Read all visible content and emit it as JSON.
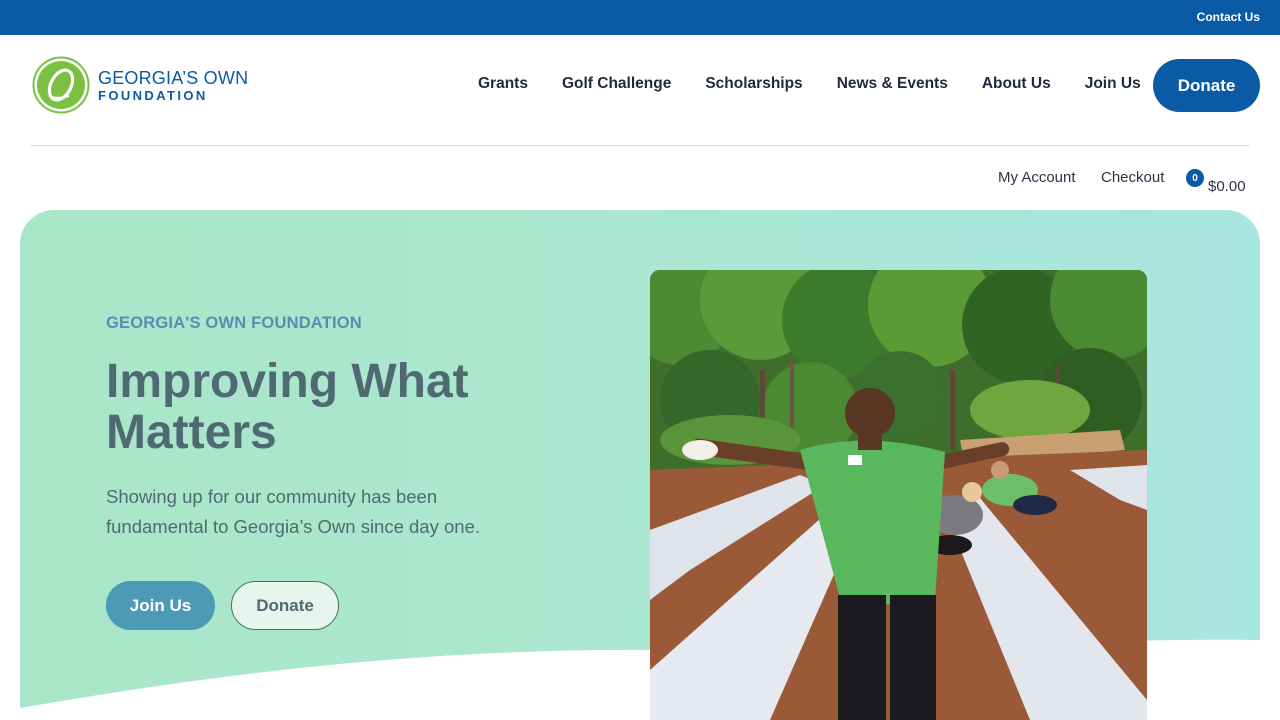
{
  "topbar": {
    "contact_label": "Contact Us"
  },
  "brand": {
    "line1": "GEORGIA’S OWN",
    "line2": "FOUNDATION",
    "color": "#0a5aa6",
    "logo_green": "#7ac143"
  },
  "nav": {
    "items": [
      {
        "label": "Grants"
      },
      {
        "label": "Golf Challenge"
      },
      {
        "label": "Scholarships"
      },
      {
        "label": "News & Events"
      },
      {
        "label": "About Us"
      },
      {
        "label": "Join Us"
      }
    ],
    "donate_label": "Donate"
  },
  "account": {
    "my_account_label": "My Account",
    "checkout_label": "Checkout",
    "cart_count": "0",
    "cart_total": "$0.00"
  },
  "hero": {
    "eyebrow": "GEORGIA'S OWN FOUNDATION",
    "headline": "Improving What Matters",
    "subcopy": "Showing up for our community has been fundamental to Georgia’s Own since day one.",
    "primary_cta": "Join Us",
    "secondary_cta": "Donate"
  },
  "colors": {
    "primary_blue": "#0a5aa6",
    "hero_mint": "#a9e6c8",
    "hero_aqua": "#a8e6e0",
    "text_slate": "#4f6a72",
    "cta_teal": "#4d9ab6"
  }
}
